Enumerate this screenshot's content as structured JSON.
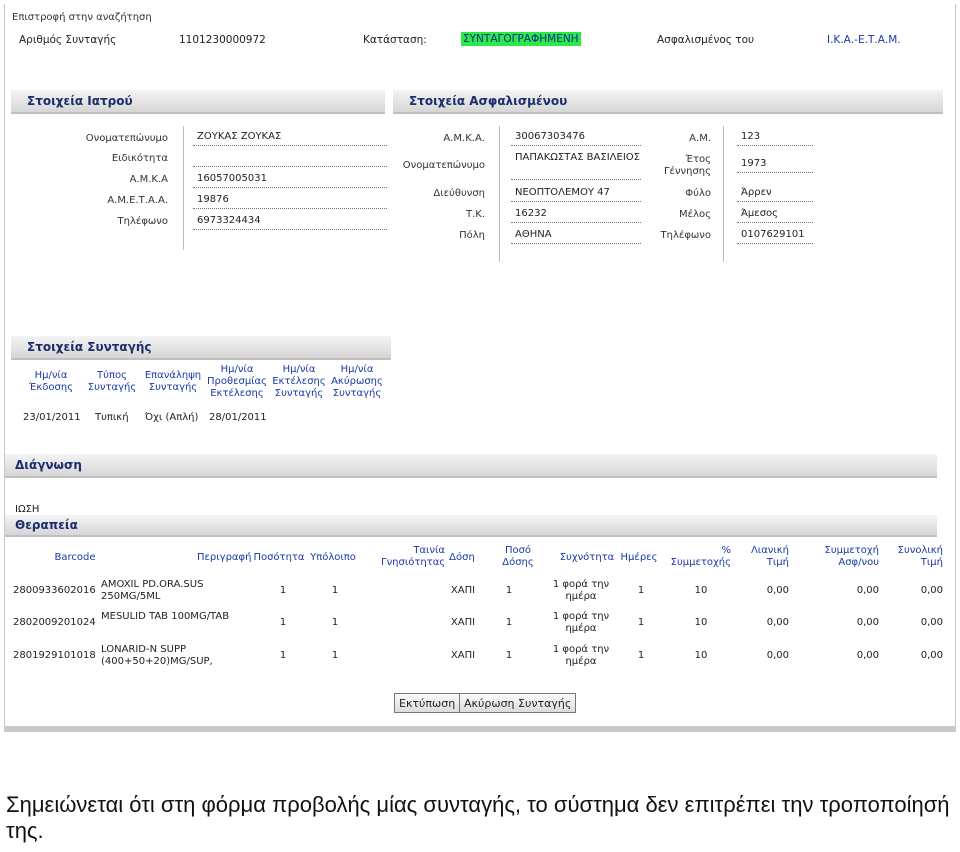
{
  "header": {
    "back_link": "Επιστροφή στην αναζήτηση",
    "rx_number_label": "Αριθμός Συνταγής",
    "rx_number": "1101230000972",
    "status_label": "Κατάσταση:",
    "status": "ΣΥΝΤΑΓΟΓΡΑΦΗΜΕΝΗ",
    "insured_of_label": "Ασφαλισμένος του",
    "insurer": "Ι.Κ.Α.-Ε.Τ.Α.Μ."
  },
  "doctor": {
    "title": "Στοιχεία Ιατρού",
    "fields": [
      {
        "label": "Ονοματεπώνυμο",
        "value": "ΖΟΥΚΑΣ ΖΟΥΚΑΣ"
      },
      {
        "label": "Ειδικότητα",
        "value": ""
      },
      {
        "label": "Α.Μ.Κ.Α",
        "value": "16057005031"
      },
      {
        "label": "Α.Μ.Ε.Τ.Α.Α.",
        "value": "19876"
      },
      {
        "label": "Τηλέφωνο",
        "value": "6973324434"
      }
    ]
  },
  "insured": {
    "title": "Στοιχεία Ασφαλισμένου",
    "left": [
      {
        "label": "Α.Μ.Κ.Α.",
        "value": "30067303476"
      },
      {
        "label": "Ονοματεπώνυμο",
        "value": "ΠΑΠΑΚΩΣΤΑΣ ΒΑΣΙΛΕΙΟΣ"
      },
      {
        "label": "Διεύθυνση",
        "value": "ΝΕΟΠΤΟΛΕΜΟΥ 47"
      },
      {
        "label": "Τ.Κ.",
        "value": "16232"
      },
      {
        "label": "Πόλη",
        "value": "ΑΘΗΝΑ"
      }
    ],
    "right": [
      {
        "label": "Α.Μ.",
        "value": "123"
      },
      {
        "label": "Έτος Γέννησης",
        "value": "1973"
      },
      {
        "label": "Φύλο",
        "value": "Άρρεν"
      },
      {
        "label": "Μέλος",
        "value": "Άμεσος"
      },
      {
        "label": "Τηλέφωνο",
        "value": "0107629101"
      }
    ]
  },
  "prescription": {
    "title": "Στοιχεία Συνταγής",
    "columns": [
      "Ημ/νία Έκδοσης",
      "Τύπος Συνταγής",
      "Επανάληψη Συνταγής",
      "Ημ/νία Προθεσμίας Εκτέλεσης",
      "Ημ/νία Εκτέλεσης Συνταγής",
      "Ημ/νία Ακύρωσης Συνταγής"
    ],
    "values": [
      "23/01/2011",
      "Τυπική",
      "Όχι (Απλή)",
      "28/01/2011",
      "",
      ""
    ]
  },
  "diagnosis": {
    "title": "Διάγνωση",
    "text": "ΙΩΣΗ"
  },
  "therapy": {
    "title": "Θεραπεία",
    "columns": [
      "Barcode",
      "Περιγραφή",
      "Ποσότητα",
      "Υπόλοιπο",
      "Ταινία Γνησιότητας",
      "Δόση",
      "Ποσό Δόσης",
      "Συχνότητα",
      "Ημέρες",
      "% Συμμετοχής",
      "Λιανική Τιμή",
      "Συμμετοχή Ασφ/νου",
      "Συνολική Τιμή"
    ],
    "rows": [
      [
        "2800933602016",
        "AMOXIL PD.ORA.SUS 250MG/5ML",
        "1",
        "1",
        "",
        "ΧΑΠΙ",
        "1",
        "1 φορά την ημέρα",
        "1",
        "10",
        "0,00",
        "0,00",
        "0,00"
      ],
      [
        "2802009201024",
        "MESULID TAB 100MG/TAB",
        "1",
        "1",
        "",
        "ΧΑΠΙ",
        "1",
        "1 φορά την ημέρα",
        "1",
        "10",
        "0,00",
        "0,00",
        "0,00"
      ],
      [
        "2801929101018",
        "LONARID-N SUPP (400+50+20)MG/SUP,",
        "1",
        "1",
        "",
        "ΧΑΠΙ",
        "1",
        "1 φορά την ημέρα",
        "1",
        "10",
        "0,00",
        "0,00",
        "0,00"
      ]
    ]
  },
  "buttons": {
    "print": "Εκτύπωση",
    "cancel": "Ακύρωση Συνταγής"
  },
  "caption": "Σημειώνεται ότι στη φόρμα προβολής μίας συνταγής, το σύστημα δεν επιτρέπει την τροποποίησή της.",
  "colors": {
    "status_bg": "#2ee84a",
    "status_text": "#0a2d8a",
    "section_title": "#1c2d6e",
    "column_header": "#1a3aa8"
  }
}
